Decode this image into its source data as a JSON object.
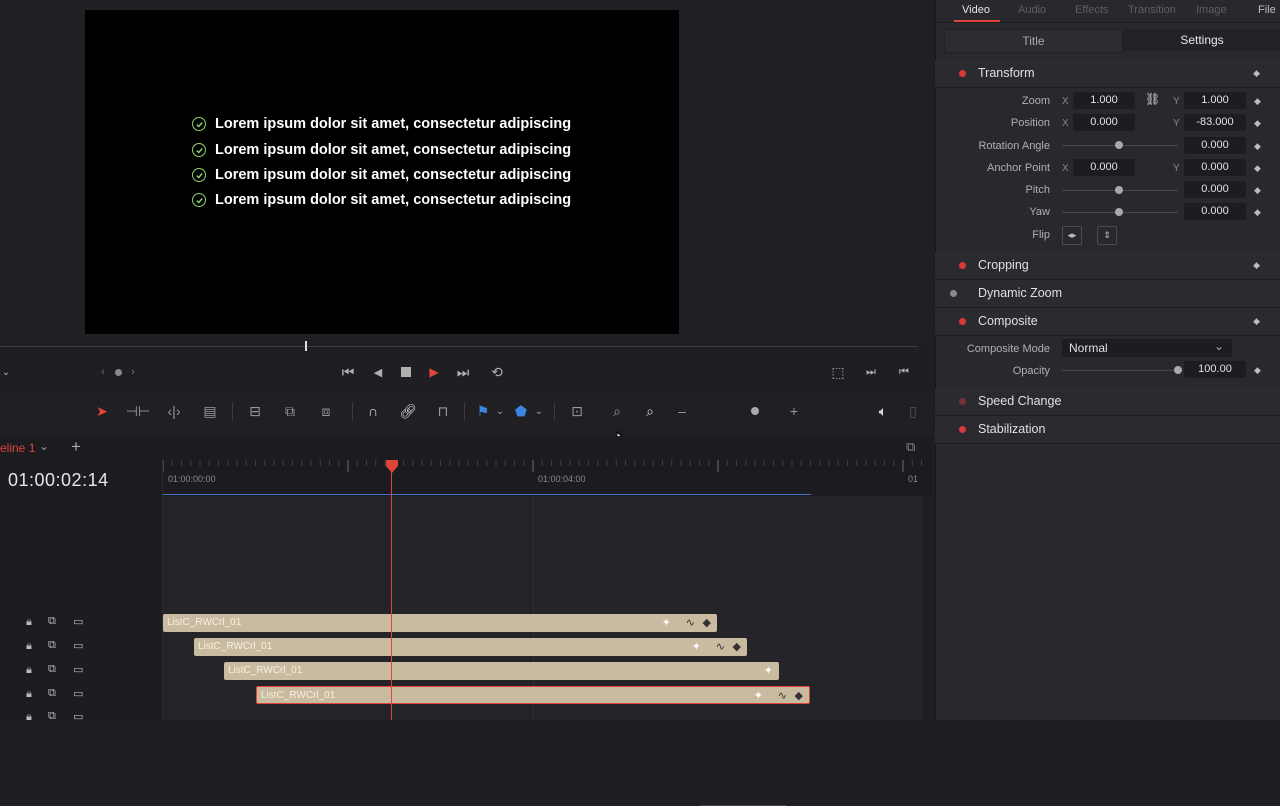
{
  "preview": {
    "bullets": [
      "Lorem ipsum dolor sit amet, consectetur adipiscing",
      "Lorem ipsum dolor sit amet, consectetur adipiscing",
      "Lorem ipsum dolor sit amet, consectetur adipiscing",
      "Lorem ipsum dolor sit amet, consectetur adipiscing"
    ]
  },
  "timeline": {
    "tab_label": "eline 1",
    "timecode": "01:00:02:14",
    "ruler_labels": [
      "01:00:00:00",
      "01:00:04:00",
      "01"
    ],
    "clips": [
      {
        "label": "ListC_RWCrl_01",
        "selected": false
      },
      {
        "label": "ListC_RWCrl_01",
        "selected": false
      },
      {
        "label": "ListC_RWCrl_01",
        "selected": false
      },
      {
        "label": "ListC_RWCrl_01",
        "selected": true
      }
    ]
  },
  "inspector": {
    "tabs": [
      "Video",
      "Audio",
      "Effects",
      "Transition",
      "Image",
      "File"
    ],
    "active_tab": "Video",
    "subtabs": [
      "Title",
      "Settings"
    ],
    "active_subtab": "Settings",
    "transform": {
      "label": "Transform",
      "zoom_label": "Zoom",
      "zoom_x": "1.000",
      "zoom_y": "1.000",
      "position_label": "Position",
      "position_x": "0.000",
      "position_y": "-83.000",
      "rotation_label": "Rotation Angle",
      "rotation": "0.000",
      "anchor_label": "Anchor Point",
      "anchor_x": "0.000",
      "anchor_y": "0.000",
      "pitch_label": "Pitch",
      "pitch": "0.000",
      "yaw_label": "Yaw",
      "yaw": "0.000",
      "flip_label": "Flip",
      "axis_x": "X",
      "axis_y": "Y"
    },
    "sections": {
      "cropping": "Cropping",
      "dynamic_zoom": "Dynamic Zoom",
      "composite": "Composite",
      "speed_change": "Speed Change",
      "stabilization": "Stabilization"
    },
    "composite": {
      "mode_label": "Composite Mode",
      "mode_value": "Normal",
      "opacity_label": "Opacity",
      "opacity_value": "100.00"
    }
  },
  "colors": {
    "accent_red": "#d9393b",
    "clip_fill": "#c9bba0",
    "check_green": "#8fd46e"
  }
}
